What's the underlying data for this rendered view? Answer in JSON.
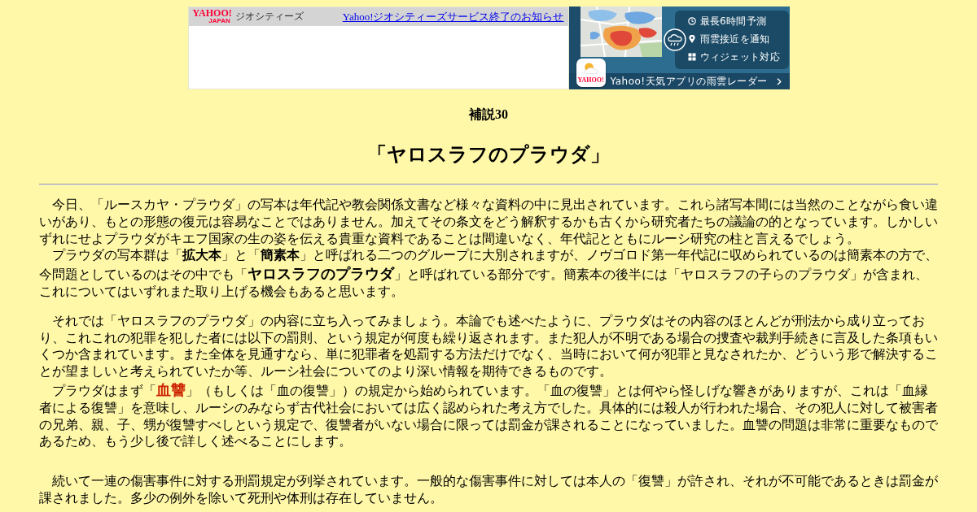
{
  "banner": {
    "logo": {
      "name": "YAHOO!",
      "sub": "JAPAN"
    },
    "service": "ジオシティーズ",
    "notice_link": "Yahoo!ジオシティーズサービス終了のお知らせ",
    "ad": {
      "features": [
        "最長6時間予測",
        "雨雲接近を通知",
        "ウィジェット対応"
      ],
      "app_logo": "YAHOO!",
      "cta": "Yahoo!天気アプリの雨雲レーダー"
    }
  },
  "title": "補説30",
  "heading": "「ヤロスラフのプラウダ」",
  "sections": [
    {
      "paragraphs": [
        {
          "segments": [
            {
              "kind": "plain",
              "text": "今日、「ルースカヤ・プラウダ」の写本は年代記や教会関係文書など様々な資料の中に見出されています。これら諸写本間には当然のことながら食い違いがあり、もとの形態の復元は容易なことではありません。加えてその条文をどう解釈するかも古くから研究者たちの議論の的となっています。しかしいずれにせよプラウダがキエフ国家の生の姿を伝える貴重な資料であることは間違いなく、年代記とともにルーシ研究の柱と言えるでしょう。"
            }
          ]
        },
        {
          "segments": [
            {
              "kind": "plain",
              "text": "プラウダの写本群は「"
            },
            {
              "kind": "bold",
              "text": "拡大本"
            },
            {
              "kind": "plain",
              "text": "」と「"
            },
            {
              "kind": "bold",
              "text": "簡素本"
            },
            {
              "kind": "plain",
              "text": "」と呼ばれる二つのグループに大別されますが、ノヴゴロド第一年代記に収められているのは簡素本の方で、今問題としているのはその中でも「"
            },
            {
              "kind": "large",
              "text": "ヤロスラフのプラウダ"
            },
            {
              "kind": "plain",
              "text": "」と呼ばれている部分です。簡素本の後半には「ヤロスラフの子らのプラウダ」が含まれ、これについてはいずれまた取り上げる機会もあると思います。"
            }
          ]
        }
      ]
    },
    {
      "paragraphs": [
        {
          "segments": [
            {
              "kind": "plain",
              "text": "それでは「ヤロスラフのプラウダ」の内容に立ち入ってみましょう。本論でも述べたように、プラウダはその内容のほとんどが刑法から成り立っており、これこれの犯罪を犯した者には以下の罰則、という規定が何度も繰り返されます。また犯人が不明である場合の捜査や裁判手続きに言及した条項もいくつか含まれています。また全体を見通すなら、単に犯罪者を処罰する方法だけでなく、当時において何が犯罪と見なされたか、どういう形で解決することが望ましいと考えられていたか等、ルーシ社会についてのより深い情報を期待できるものです。"
            }
          ]
        },
        {
          "segments": [
            {
              "kind": "plain",
              "text": "プラウダはまず「"
            },
            {
              "kind": "keyword",
              "text": "血讐"
            },
            {
              "kind": "plain",
              "text": "」（もしくは「血の復讐」）の規定から始められています。「血の復讐」とは何やら怪しげな響きがありますが、これは「血縁者による復讐」を意味し、ルーシのみならず古代社会においては広く認められた考え方でした。具体的には殺人が行われた場合、その犯人に対して被害者の兄弟、親、子、甥が復讐すべしという規定で、復讐者がいない場合に限っては罰金が課されることになっていました。血讐の問題は非常に重要なものであるため、もう少し後で詳しく述べることにします。"
            }
          ]
        }
      ]
    },
    {
      "paragraphs": [
        {
          "segments": [
            {
              "kind": "plain",
              "text": "続いて一連の傷害事件に対する刑罰規定が列挙されています。一般的な傷害事件に対しては本人の「復讐」が許され、それが不可能であるときは罰金が課されました。多少の例外を除いて死刑や体刑は存在していません。"
            }
          ]
        }
      ]
    }
  ]
}
